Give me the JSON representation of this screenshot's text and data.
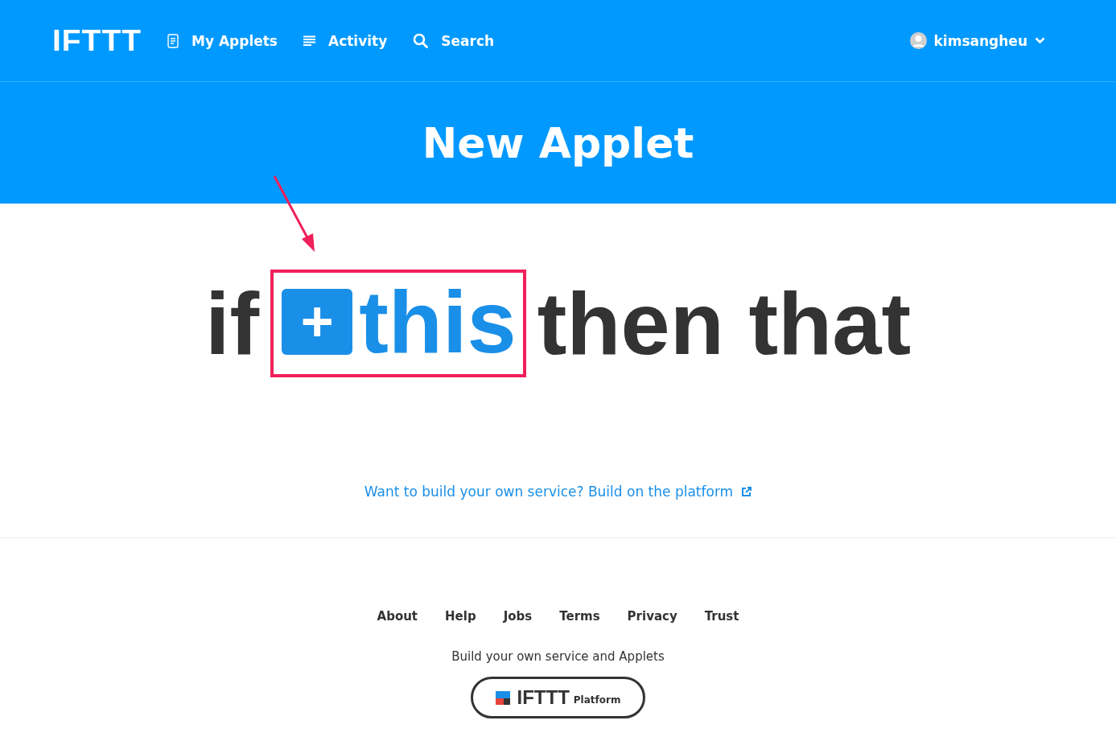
{
  "header": {
    "logo": "IFTTT",
    "nav": [
      {
        "kind": "applets",
        "label": "My Applets"
      },
      {
        "kind": "activity",
        "label": "Activity"
      },
      {
        "kind": "search",
        "label": "Search"
      }
    ],
    "user": {
      "name": "kimsangheu"
    }
  },
  "hero": {
    "title": "New Applet"
  },
  "statement": {
    "if": "if",
    "plus": "+",
    "this": "this",
    "then_that": "then that",
    "highlighted": true
  },
  "platform_link": "Want to build your own service? Build on the platform",
  "footer": {
    "links": [
      "About",
      "Help",
      "Jobs",
      "Terms",
      "Privacy",
      "Trust"
    ],
    "tagline": "Build your own service and Applets",
    "badge": {
      "logo": "IFTTT",
      "label": "Platform"
    }
  }
}
